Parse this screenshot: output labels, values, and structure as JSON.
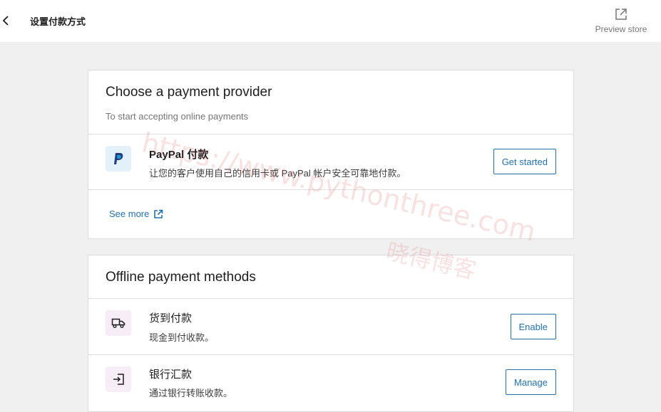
{
  "header": {
    "title": "设置付款方式",
    "preview_label": "Preview store"
  },
  "providers": {
    "title": "Choose a payment provider",
    "subtitle": "To start accepting online payments",
    "items": [
      {
        "name": "PayPal 付款",
        "description": "让您的客户使用自己的信用卡或 PayPal 帐户安全可靠地付款。",
        "button": "Get started",
        "logo_text": "PayPal"
      }
    ],
    "see_more": "See more"
  },
  "offline": {
    "title": "Offline payment methods",
    "items": [
      {
        "name": "货到付款",
        "description": "现金到付收款。",
        "button": "Enable",
        "icon": "truck-icon"
      },
      {
        "name": "银行汇款",
        "description": "通过银行转账收款。",
        "button": "Manage",
        "icon": "bank-transfer-icon"
      }
    ]
  },
  "watermark": {
    "url": "https://www.pythonthree.com",
    "name": "晓得博客"
  },
  "colors": {
    "accent": "#2271b1",
    "icon_bg": "#f7edf7",
    "paypal_bg": "#e3f1fb"
  }
}
